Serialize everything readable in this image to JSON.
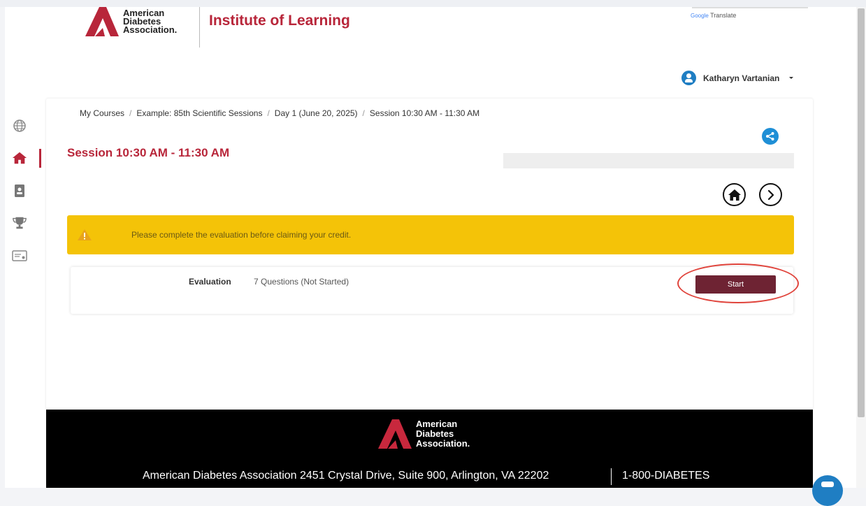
{
  "header": {
    "logo_lines": [
      "American",
      "Diabetes",
      "Association."
    ],
    "institute_title": "Institute of Learning",
    "google_translate": {
      "brand": "Google",
      "label": "Translate"
    }
  },
  "user": {
    "name": "Katharyn Vartanian"
  },
  "sidenav": {
    "items": [
      {
        "name": "globe",
        "icon": "globe-icon"
      },
      {
        "name": "home",
        "icon": "home-icon",
        "active": true
      },
      {
        "name": "contacts",
        "icon": "contact-book-icon"
      },
      {
        "name": "achievements",
        "icon": "trophy-icon"
      },
      {
        "name": "certificates",
        "icon": "certificate-icon"
      }
    ]
  },
  "breadcrumb": [
    "My Courses",
    "Example: 85th Scientific Sessions",
    "Day 1 (June 20, 2025)",
    "Session 10:30 AM - 11:30 AM"
  ],
  "session": {
    "title": "Session 10:30 AM - 11:30 AM"
  },
  "alert": {
    "message": "Please complete the evaluation before claiming your credit."
  },
  "evaluation": {
    "label": "Evaluation",
    "status": "7 Questions (Not Started)",
    "button_label": "Start"
  },
  "footer": {
    "logo_lines": [
      "American",
      "Diabetes",
      "Association."
    ],
    "address": "American Diabetes Association 2451 Crystal Drive, Suite 900, Arlington, VA 22202",
    "phone": "1-800-DIABETES"
  },
  "colors": {
    "brand_red": "#b8263a",
    "alert_yellow": "#f4c308",
    "start_button": "#6e2333",
    "accent_blue": "#1f8fd6"
  }
}
